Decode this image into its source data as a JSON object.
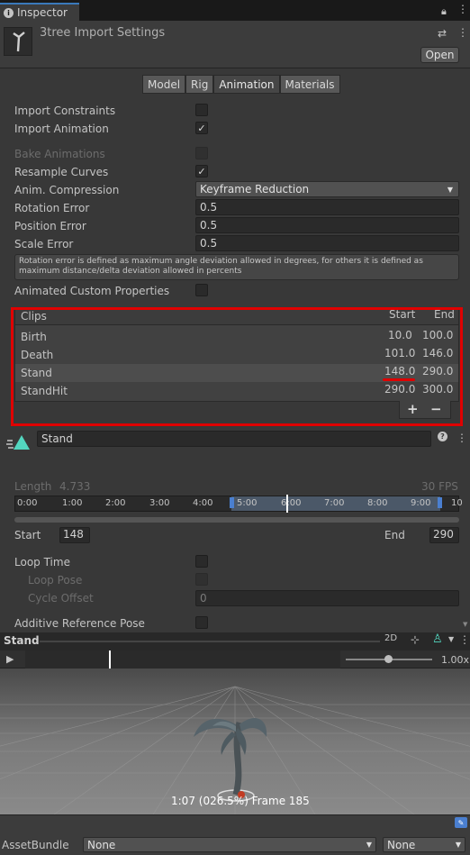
{
  "window": {
    "tab_label": "Inspector"
  },
  "header": {
    "title": "3tree Import Settings",
    "open_label": "Open"
  },
  "tabs": [
    "Model",
    "Rig",
    "Animation",
    "Materials"
  ],
  "settings": {
    "import_constraints": "Import Constraints",
    "import_animation": "Import Animation",
    "bake_animations": "Bake Animations",
    "resample_curves": "Resample Curves",
    "anim_compression": "Anim. Compression",
    "anim_compression_value": "Keyframe Reduction",
    "rotation_error": "Rotation Error",
    "rotation_error_value": "0.5",
    "position_error": "Position Error",
    "position_error_value": "0.5",
    "scale_error": "Scale Error",
    "scale_error_value": "0.5",
    "help_text": "Rotation error is defined as maximum angle deviation allowed in degrees, for others it is defined as maximum distance/delta deviation allowed in percents",
    "animated_custom_properties": "Animated Custom Properties"
  },
  "clips": {
    "header": "Clips",
    "start_header": "Start",
    "end_header": "End",
    "rows": [
      {
        "name": "Birth",
        "start": "10.0",
        "end": "100.0"
      },
      {
        "name": "Death",
        "start": "101.0",
        "end": "146.0"
      },
      {
        "name": "Stand",
        "start": "148.0",
        "end": "290.0"
      },
      {
        "name": "StandHit",
        "start": "290.0",
        "end": "300.0"
      }
    ],
    "add": "+",
    "remove": "−"
  },
  "clip_detail": {
    "name": "Stand",
    "length_label": "Length",
    "length_value": "4.733",
    "fps": "30 FPS",
    "ticks": [
      "0:00",
      "1:00",
      "2:00",
      "3:00",
      "4:00",
      "5:00",
      "6:00",
      "7:00",
      "8:00",
      "9:00",
      "10"
    ],
    "start_label": "Start",
    "start_value": "148",
    "end_label": "End",
    "end_value": "290",
    "loop_time": "Loop Time",
    "loop_pose": "Loop Pose",
    "cycle_offset": "Cycle Offset",
    "cycle_offset_value": "0",
    "additive_reference_pose": "Additive Reference Pose"
  },
  "preview": {
    "title": "Stand",
    "mode_2d": "2D",
    "speed": "1.00x",
    "status": "1:07 (026.5%) Frame 185"
  },
  "assetbundle": {
    "label": "AssetBundle",
    "value": "None",
    "variant": "None"
  }
}
